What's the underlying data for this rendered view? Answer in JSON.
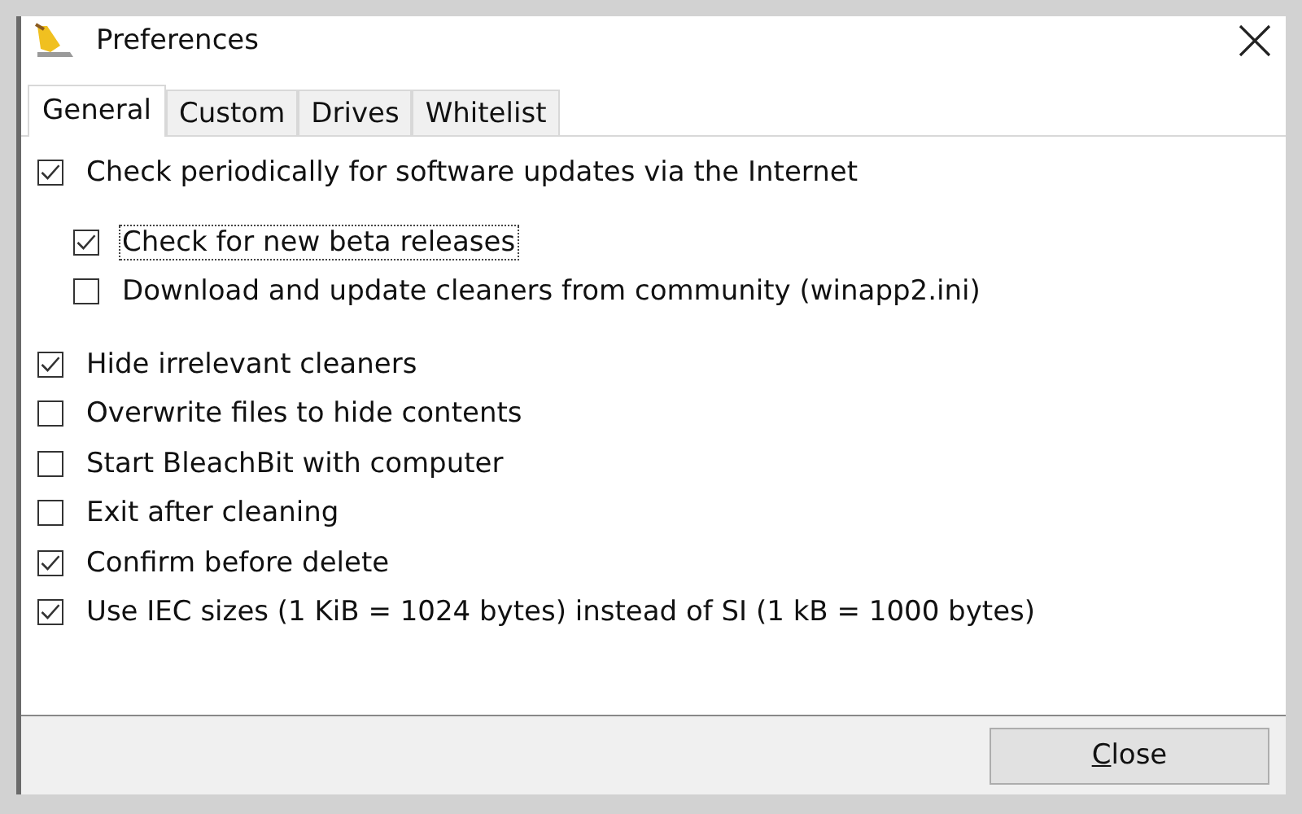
{
  "window": {
    "title": "Preferences"
  },
  "tabs": [
    {
      "label": "General",
      "selected": true
    },
    {
      "label": "Custom",
      "selected": false
    },
    {
      "label": "Drives",
      "selected": false
    },
    {
      "label": "Whitelist",
      "selected": false
    }
  ],
  "options": [
    {
      "label": "Check periodically for software updates via the Internet",
      "checked": true,
      "focused": false,
      "children": [
        {
          "label": "Check for new beta releases",
          "checked": true,
          "focused": true
        },
        {
          "label": "Download and update cleaners from community (winapp2.ini)",
          "checked": false,
          "focused": false
        }
      ]
    },
    {
      "label": "Hide irrelevant cleaners",
      "checked": true,
      "focused": false
    },
    {
      "label": "Overwrite files to hide contents",
      "checked": false,
      "focused": false
    },
    {
      "label": "Start BleachBit with computer",
      "checked": false,
      "focused": false
    },
    {
      "label": "Exit after cleaning",
      "checked": false,
      "focused": false
    },
    {
      "label": "Confirm before delete",
      "checked": true,
      "focused": false
    },
    {
      "label": "Use IEC sizes (1 KiB = 1024 bytes) instead of SI (1 kB = 1000 bytes)",
      "checked": true,
      "focused": false
    }
  ],
  "buttons": [
    {
      "label": "Close"
    }
  ]
}
